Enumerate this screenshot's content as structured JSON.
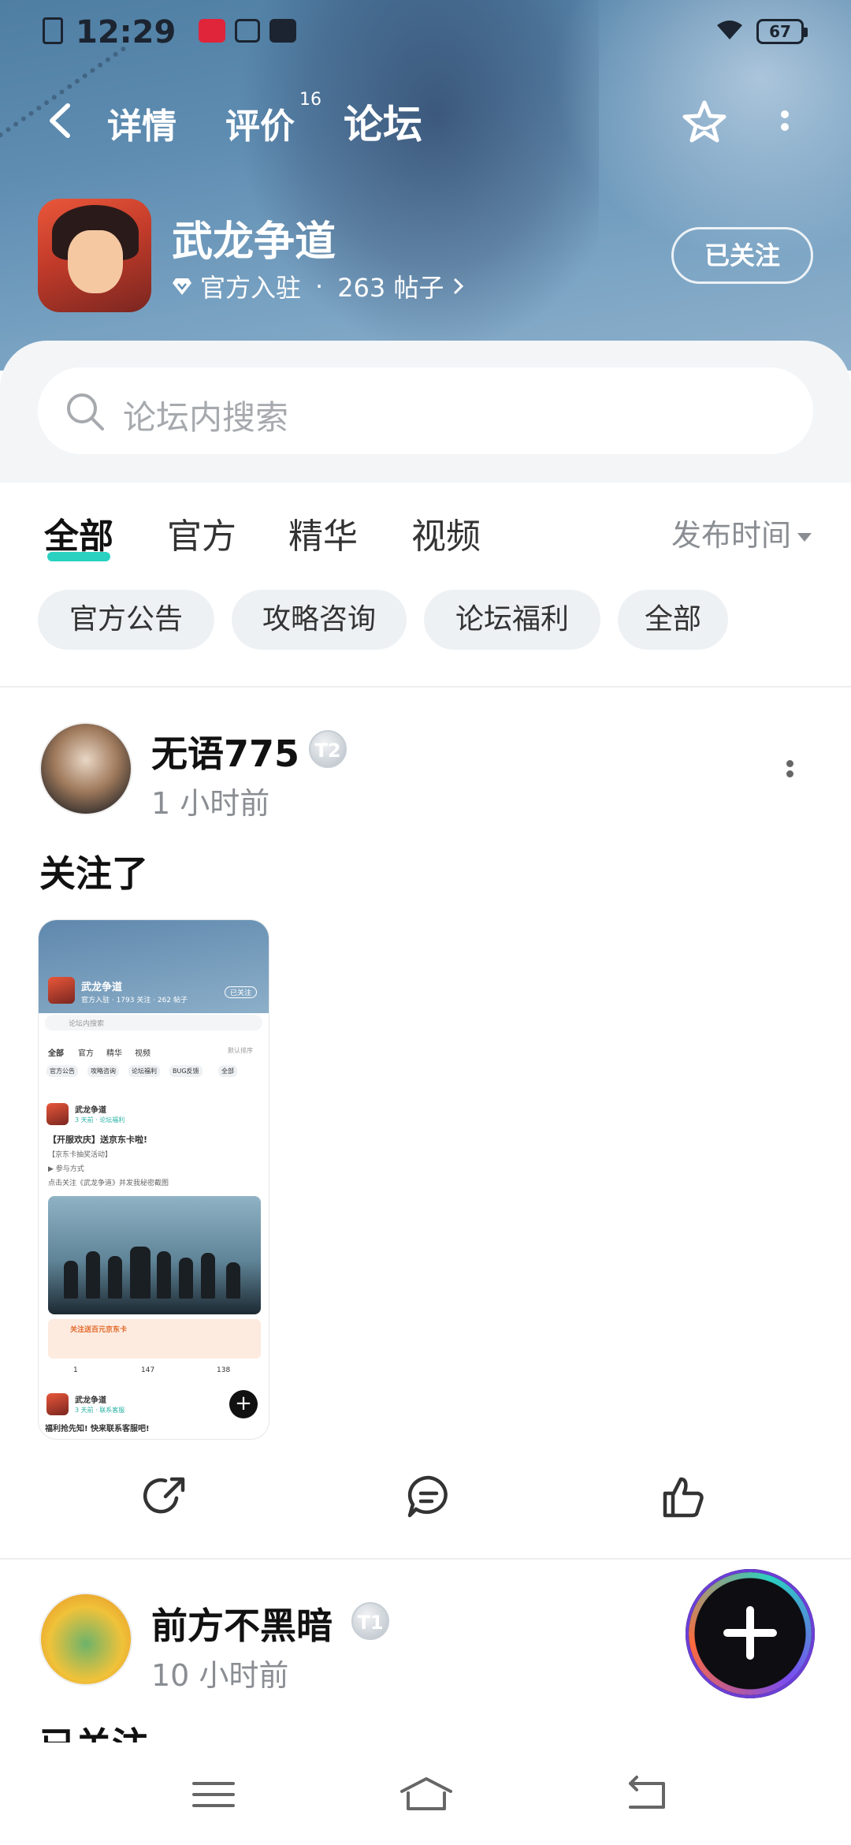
{
  "status_bar": {
    "time": "12:29",
    "battery": "67"
  },
  "nav": {
    "tabs": [
      {
        "label": "详情"
      },
      {
        "label": "评价",
        "badge": "16"
      },
      {
        "label": "论坛",
        "active": true
      }
    ]
  },
  "forum": {
    "name": "武龙争道",
    "official": "官方入驻",
    "separator": "·",
    "post_count": "263 帖子",
    "follow_label": "已关注"
  },
  "search": {
    "placeholder": "论坛内搜索"
  },
  "sub_tabs": [
    "全部",
    "官方",
    "精华",
    "视频"
  ],
  "sort_label": "发布时间",
  "chips": [
    "官方公告",
    "攻略咨询",
    "论坛福利",
    "全部"
  ],
  "posts": [
    {
      "user": "无语775",
      "level": "T2",
      "time": "1 小时前",
      "text": "关注了",
      "screenshot": {
        "forum_name": "武龙争道",
        "meta": "官方入驻 · 1793 关注 · 262 帖子",
        "follow": "已关注",
        "search": "论坛内搜索",
        "tabs": [
          "全部",
          "官方",
          "精华",
          "视频"
        ],
        "sort": "默认排序",
        "chips": [
          "官方公告",
          "攻略咨询",
          "论坛福利",
          "BUG反馈",
          "全部"
        ],
        "post_author": "武龙争道",
        "post_time": "3 天前 · 论坛福利",
        "post_title": "【开服欢庆】送京东卡啦!",
        "post_sub": "【京东卡抽奖活动】",
        "post_line": "▶ 参与方式",
        "post_desc": "点击关注《武龙争道》并发我秘密截图",
        "banner": "关注送百元京东卡",
        "counts": [
          "1",
          "147",
          "138"
        ],
        "post2_author": "武龙争道",
        "post2_time": "3 天前 · 联系客服",
        "post2_title": "福利抢先知! 快来联系客服吧!"
      }
    },
    {
      "user": "前方不黑暗",
      "level": "T1",
      "time": "10 小时前",
      "text": "已关注"
    }
  ],
  "colors": {
    "accent": "#2ad1c1",
    "header": "#5f8db2"
  }
}
